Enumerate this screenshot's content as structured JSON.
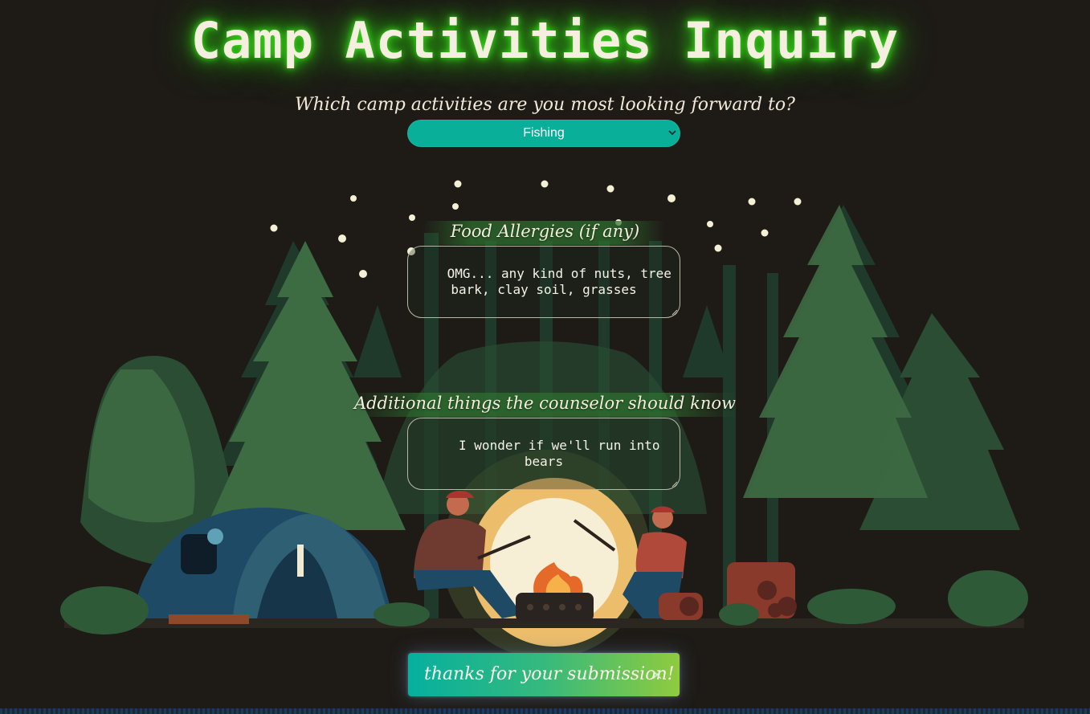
{
  "header": {
    "title": "Camp Activities Inquiry",
    "glow_color": "#3bdc1d"
  },
  "activities": {
    "question": "Which camp activities are you most looking forward to?",
    "selected": "Fishing",
    "accent": "#0aaf99"
  },
  "allergies": {
    "label": "Food Allergies (if any)",
    "value": "OMG... any kind of nuts, tree bark, clay soil, grasses"
  },
  "notes": {
    "label": "Additional things the counselor should know",
    "value": "I wonder if we'll run into bears"
  },
  "toast": {
    "message": "thanks for your submission!",
    "close_glyph": "×"
  },
  "icons": {
    "select_caret": "chevron-down-icon",
    "toast_close": "close-icon",
    "textarea_grip": "resize-grip-icon"
  }
}
